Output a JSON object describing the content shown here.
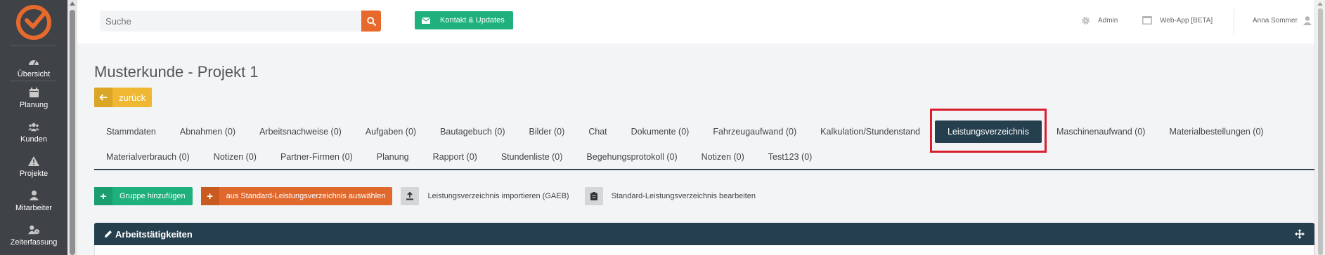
{
  "sidebar": {
    "items": [
      {
        "label": "Übersicht",
        "icon": "dashboard-icon"
      },
      {
        "label": "Planung",
        "icon": "calendar-icon"
      },
      {
        "label": "Kunden",
        "icon": "users-icon"
      },
      {
        "label": "Projekte",
        "icon": "warning-icon"
      },
      {
        "label": "Mitarbeiter",
        "icon": "user-icon"
      },
      {
        "label": "Zeiterfassung",
        "icon": "user-clock-icon"
      }
    ]
  },
  "topbar": {
    "search_placeholder": "Suche",
    "contact_label": "Kontakt & Updates",
    "admin_label": "Admin",
    "webapp_label": "Web-App [BETA]",
    "user_name": "Anna Sommer"
  },
  "page": {
    "title": "Musterkunde - Projekt 1",
    "back_label": "zurück"
  },
  "tabs": {
    "row1": [
      "Stammdaten",
      "Abnahmen (0)",
      "Arbeitsnachweise (0)",
      "Aufgaben (0)",
      "Bautagebuch (0)",
      "Bilder (0)",
      "Chat",
      "Dokumente (0)",
      "Fahrzeugaufwand (0)",
      "Kalkulation/Stundenstand",
      "Leistungsverzeichnis",
      "Maschinenaufwand (0)",
      "Materialbestellungen (0)"
    ],
    "row2": [
      "Materialverbrauch (0)",
      "Notizen (0)",
      "Partner-Firmen (0)",
      "Planung",
      "Rapport (0)",
      "Stundenliste (0)",
      "Begehungsprotokoll (0)",
      "Notizen (0)",
      "Test123 (0)"
    ],
    "active": "Leistungsverzeichnis"
  },
  "actions": {
    "add_group": "Gruppe hinzufügen",
    "from_standard": "aus Standard-Leistungsverzeichnis auswählen",
    "import_gaeb": "Leistungsverzeichnis importieren (GAEB)",
    "edit_standard": "Standard-Leistungsverzeichnis bearbeiten"
  },
  "panel": {
    "title": "Arbeitstätigkeiten"
  },
  "colors": {
    "sidebar": "#3f4347",
    "accent_orange": "#e8692c",
    "accent_green": "#1fb17d",
    "dark_blue": "#263f4f",
    "back_yellow": "#f0b832",
    "highlight_red": "#d8202d"
  }
}
